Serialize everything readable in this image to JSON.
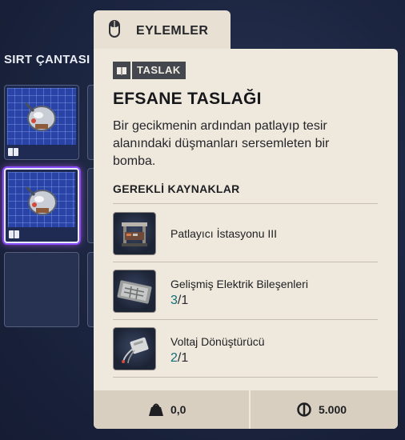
{
  "background": {
    "backpack_title": "SIRT ÇANTASI"
  },
  "tab": {
    "label": "EYLEMLER",
    "icon": "mouse-icon"
  },
  "tooltip": {
    "tag": "TASLAK",
    "tag_icon": "blueprint-book-icon",
    "title": "EFSANE TASLAĞI",
    "description": "Bir gecikmenin ardından patlayıp tesir alanındaki düşmanları sersemleten bir bomba.",
    "required_title": "GEREKLİ KAYNAKLAR",
    "resources": [
      {
        "name": "Patlayıcı İstasyonu III",
        "icon": "workbench-icon",
        "have": "",
        "need": ""
      },
      {
        "name": "Gelişmiş Elektrik Bileşenleri",
        "icon": "circuit-board-icon",
        "have": "3",
        "need": "/1"
      },
      {
        "name": "Voltaj Dönüştürücü",
        "icon": "voltage-converter-icon",
        "have": "2",
        "need": "/1"
      }
    ],
    "weight": "0,0",
    "price": "5.000",
    "weight_icon": "weight-icon",
    "price_icon": "coin-icon"
  },
  "colors": {
    "panel_bg": "#efe8dc",
    "accent_teal": "#0f6f7b",
    "selection_glow": "#8a4cff"
  }
}
